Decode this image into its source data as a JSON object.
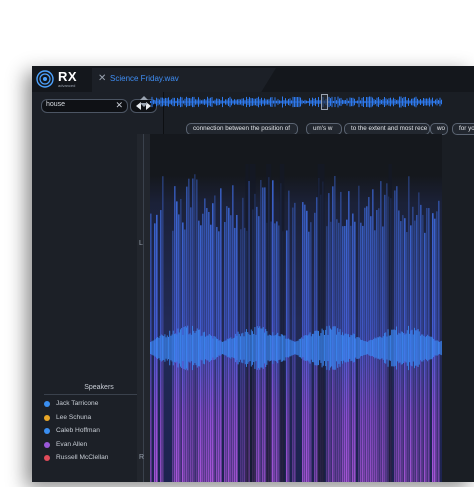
{
  "app": {
    "logo_text": "RX",
    "logo_sub": "advanced",
    "tab": {
      "close_glyph": "✕",
      "label": "Science Friday.wav"
    }
  },
  "search": {
    "value": "house",
    "clear_glyph": "✕"
  },
  "speakers": {
    "title": "Speakers",
    "items": [
      {
        "name": "Jack Tarricone",
        "color": "#3a8ef0"
      },
      {
        "name": "Lee Schuna",
        "color": "#e8a627"
      },
      {
        "name": "Caleb Hoffman",
        "color": "#3a8ef0"
      },
      {
        "name": "Evan Allen",
        "color": "#9a58d8"
      },
      {
        "name": "Russell McClellan",
        "color": "#e04b5a"
      }
    ]
  },
  "transcript_chips": [
    "connection between the position of",
    "um's w",
    "to the extent and most rece",
    "wo",
    "for yo"
  ],
  "channels": {
    "left": "L",
    "right": "R"
  },
  "icons": [
    "logo-icon",
    "close-icon",
    "clear-icon",
    "prev-icon",
    "next-icon",
    "overview-zoom-icon"
  ],
  "colors": {
    "accent": "#3f8ef5",
    "waveform": "#2e7bef",
    "spectrogram_hi": "#b14ee6"
  }
}
